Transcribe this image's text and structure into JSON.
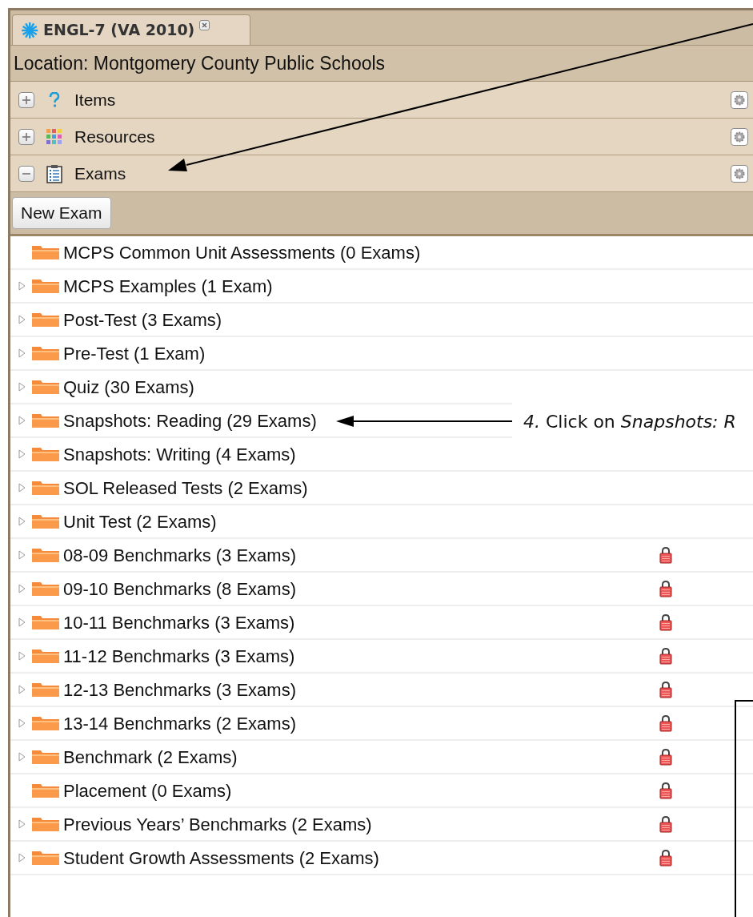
{
  "tab": {
    "title": "ENGL-7 (VA 2010)",
    "selected": true
  },
  "location": "Location: Montgomery County Public Schools",
  "sections": [
    {
      "label": "Items",
      "kind": "items",
      "expanded": false
    },
    {
      "label": "Resources",
      "kind": "resources",
      "expanded": false
    },
    {
      "label": "Exams",
      "kind": "exams",
      "expanded": true
    }
  ],
  "toolbar": {
    "button": "New Exam"
  },
  "folders": [
    {
      "name": "MCPS Common Unit Assessments (0 Exams)",
      "expandable": false,
      "locked": false
    },
    {
      "name": "MCPS Examples (1 Exam)",
      "expandable": true,
      "locked": false
    },
    {
      "name": "Post-Test (3 Exams)",
      "expandable": true,
      "locked": false
    },
    {
      "name": "Pre-Test (1 Exam)",
      "expandable": true,
      "locked": false
    },
    {
      "name": "Quiz (30 Exams)",
      "expandable": true,
      "locked": false
    },
    {
      "name": "Snapshots: Reading (29 Exams)",
      "expandable": true,
      "locked": false
    },
    {
      "name": "Snapshots: Writing (4 Exams)",
      "expandable": true,
      "locked": false
    },
    {
      "name": "SOL Released Tests (2 Exams)",
      "expandable": true,
      "locked": false
    },
    {
      "name": "Unit Test (2 Exams)",
      "expandable": true,
      "locked": false
    },
    {
      "name": "08-09 Benchmarks (3 Exams)",
      "expandable": true,
      "locked": true
    },
    {
      "name": "09-10 Benchmarks (8 Exams)",
      "expandable": true,
      "locked": true
    },
    {
      "name": "10-11 Benchmarks (3 Exams)",
      "expandable": true,
      "locked": true
    },
    {
      "name": "11-12 Benchmarks (3 Exams)",
      "expandable": true,
      "locked": true
    },
    {
      "name": "12-13 Benchmarks (3 Exams)",
      "expandable": true,
      "locked": true
    },
    {
      "name": "13-14 Benchmarks (2 Exams)",
      "expandable": true,
      "locked": true
    },
    {
      "name": "Benchmark (2 Exams)",
      "expandable": true,
      "locked": true
    },
    {
      "name": "Placement (0 Exams)",
      "expandable": false,
      "locked": true
    },
    {
      "name": "Previous Years’ Benchmarks (2 Exams)",
      "expandable": true,
      "locked": true
    },
    {
      "name": "Student Growth Assessments (2 Exams)",
      "expandable": true,
      "locked": true
    }
  ],
  "annotation": {
    "text": "*4.*  Click on *Snapshots: R*"
  }
}
